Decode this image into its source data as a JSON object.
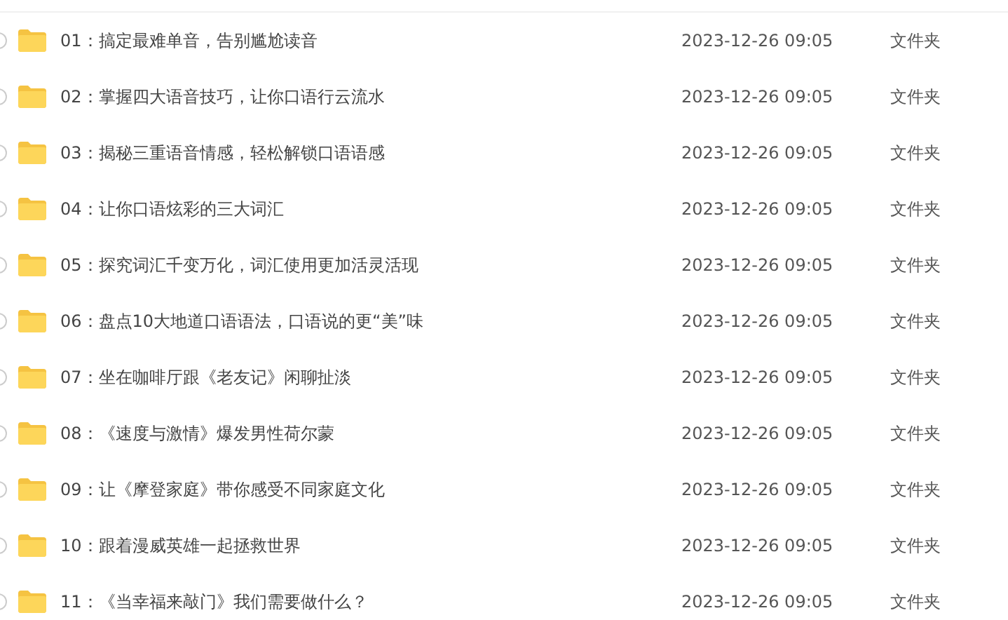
{
  "files": [
    {
      "name": "01：搞定最难单音，告别尴尬读音",
      "modified": "2023-12-26 09:05",
      "type": "文件夹",
      "checked": false
    },
    {
      "name": "02：掌握四大语音技巧，让你口语行云流水",
      "modified": "2023-12-26 09:05",
      "type": "文件夹",
      "checked": false
    },
    {
      "name": "03：揭秘三重语音情感，轻松解锁口语语感",
      "modified": "2023-12-26 09:05",
      "type": "文件夹",
      "checked": false
    },
    {
      "name": "04：让你口语炫彩的三大词汇",
      "modified": "2023-12-26 09:05",
      "type": "文件夹",
      "checked": false
    },
    {
      "name": "05：探究词汇千变万化，词汇使用更加活灵活现",
      "modified": "2023-12-26 09:05",
      "type": "文件夹",
      "checked": false
    },
    {
      "name": "06：盘点10大地道口语语法，口语说的更“美”味",
      "modified": "2023-12-26 09:05",
      "type": "文件夹",
      "checked": false
    },
    {
      "name": "07：坐在咖啡厅跟《老友记》闲聊扯淡",
      "modified": "2023-12-26 09:05",
      "type": "文件夹",
      "checked": false
    },
    {
      "name": "08：《速度与激情》爆发男性荷尔蒙",
      "modified": "2023-12-26 09:05",
      "type": "文件夹",
      "checked": false
    },
    {
      "name": "09：让《摩登家庭》带你感受不同家庭文化",
      "modified": "2023-12-26 09:05",
      "type": "文件夹",
      "checked": false
    },
    {
      "name": "10：跟着漫威英雄一起拯救世界",
      "modified": "2023-12-26 09:05",
      "type": "文件夹",
      "checked": false
    },
    {
      "name": "11：《当幸福来敲门》我们需要做什么？",
      "modified": "2023-12-26 09:05",
      "type": "文件夹",
      "checked": false
    }
  ]
}
